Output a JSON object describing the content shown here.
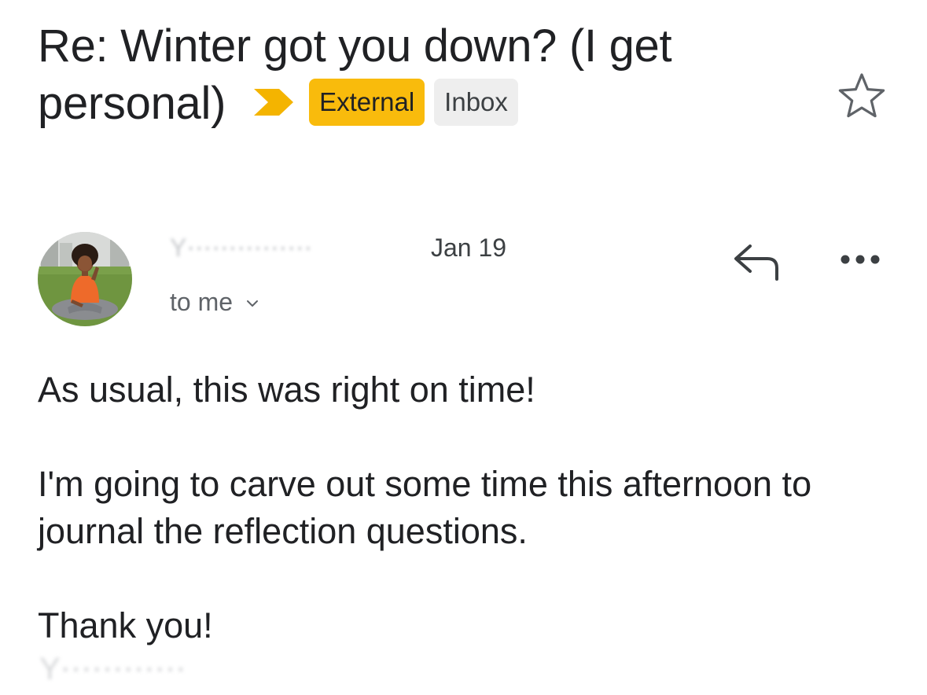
{
  "email": {
    "subject": "Re: Winter got you down? (I get personal)",
    "labels": [
      "External",
      "Inbox"
    ],
    "sender_redacted": "Y⋯⋯⋯⋯⋯",
    "date": "Jan 19",
    "recipient": "to me",
    "body": {
      "line1": "As usual, this was right on time!",
      "line2": "I'm going to carve out some time this afternoon to journal the reflection questions.",
      "line3": "Thank you!"
    },
    "signature_redacted": "Y⋯⋯⋯⋯"
  },
  "icons": {
    "importance": "importance-marker-icon",
    "star": "star-icon",
    "reply": "reply-icon",
    "more": "more-options-icon",
    "recipient_details": "chevron-down-icon"
  },
  "colors": {
    "importance": "#f4b400",
    "external_label": "#f9bb0c",
    "inbox_label": "#eeeeee",
    "text": "#202124",
    "secondary_text": "#5f6368"
  }
}
